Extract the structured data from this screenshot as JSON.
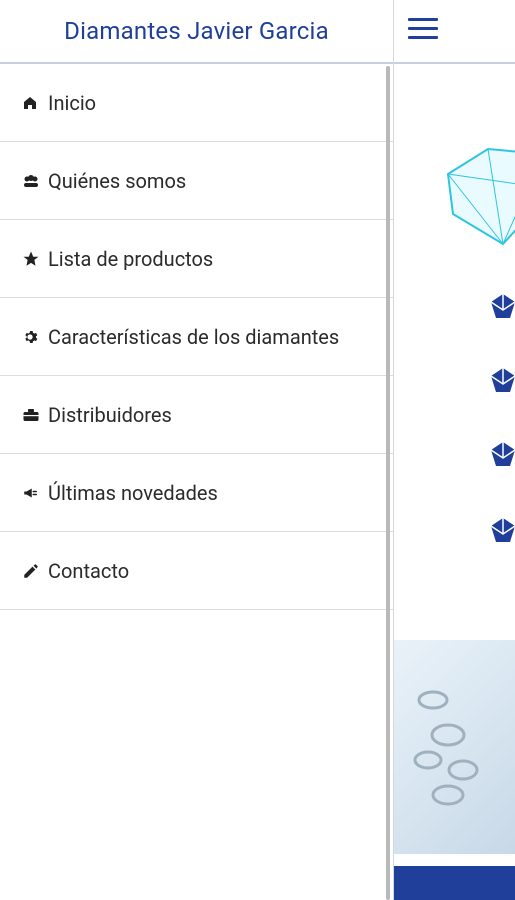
{
  "header": {
    "title": "Diamantes Javier Garcia"
  },
  "menu": {
    "items": [
      {
        "label": "Inicio",
        "icon": "home-icon"
      },
      {
        "label": "Quiénes somos",
        "icon": "group-icon"
      },
      {
        "label": "Lista de productos",
        "icon": "star-icon"
      },
      {
        "label": "Características de los diamantes",
        "icon": "gear-icon"
      },
      {
        "label": "Distribuidores",
        "icon": "briefcase-icon"
      },
      {
        "label": "Últimas novedades",
        "icon": "megaphone-icon"
      },
      {
        "label": "Contacto",
        "icon": "pencil-icon"
      }
    ]
  },
  "colors": {
    "accent": "#1f3f9a",
    "diamond": "#2ec5e0"
  }
}
